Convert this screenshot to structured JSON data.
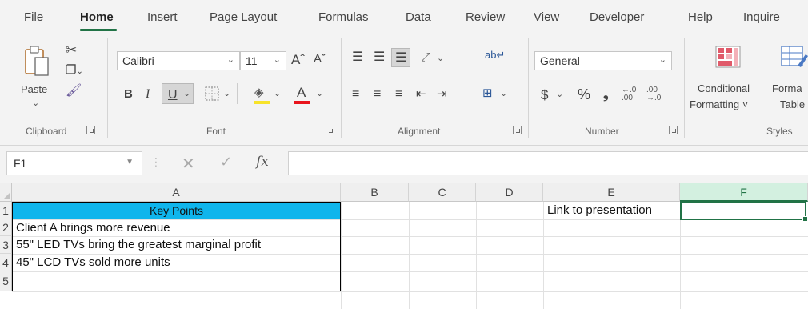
{
  "tabs": [
    "File",
    "Home",
    "Insert",
    "Page Layout",
    "Formulas",
    "Data",
    "Review",
    "View",
    "Developer",
    "Help",
    "Inquire"
  ],
  "active_tab": "Home",
  "ribbon": {
    "clipboard": {
      "paste_label": "Paste",
      "group_label": "Clipboard"
    },
    "font": {
      "font_name": "Calibri",
      "font_size": "11",
      "bold": "B",
      "italic": "I",
      "underline": "U",
      "grow": "Aˆ",
      "shrink": "Aˇ",
      "font_color_letter": "A",
      "group_label": "Font"
    },
    "alignment": {
      "group_label": "Alignment"
    },
    "number": {
      "format": "General",
      "currency": "$",
      "percent": "%",
      "comma": ")",
      "inc_dec": ".00",
      "group_label": "Number"
    },
    "styles": {
      "conditional_line1": "Conditional",
      "conditional_line2": "Formatting ˅",
      "format_table_line1": "Forma",
      "format_table_line2": "Table",
      "group_label": "Styles"
    }
  },
  "formula_bar": {
    "name_box": "F1",
    "fx_label": "fx",
    "formula": ""
  },
  "grid": {
    "columns": [
      "A",
      "B",
      "C",
      "D",
      "E",
      "F"
    ],
    "rows": [
      "1",
      "2",
      "3",
      "4",
      "5"
    ],
    "selected_cell": "F1",
    "cells": {
      "A1": "Key Points",
      "A2": "Client A brings more revenue",
      "A3": "55\" LED TVs bring the greatest marginal profit",
      "A4": "45\" LCD TVs sold more units",
      "E1": "Link to presentation"
    }
  },
  "colors": {
    "accent": "#217346",
    "header_fill": "#0fb5ec"
  }
}
